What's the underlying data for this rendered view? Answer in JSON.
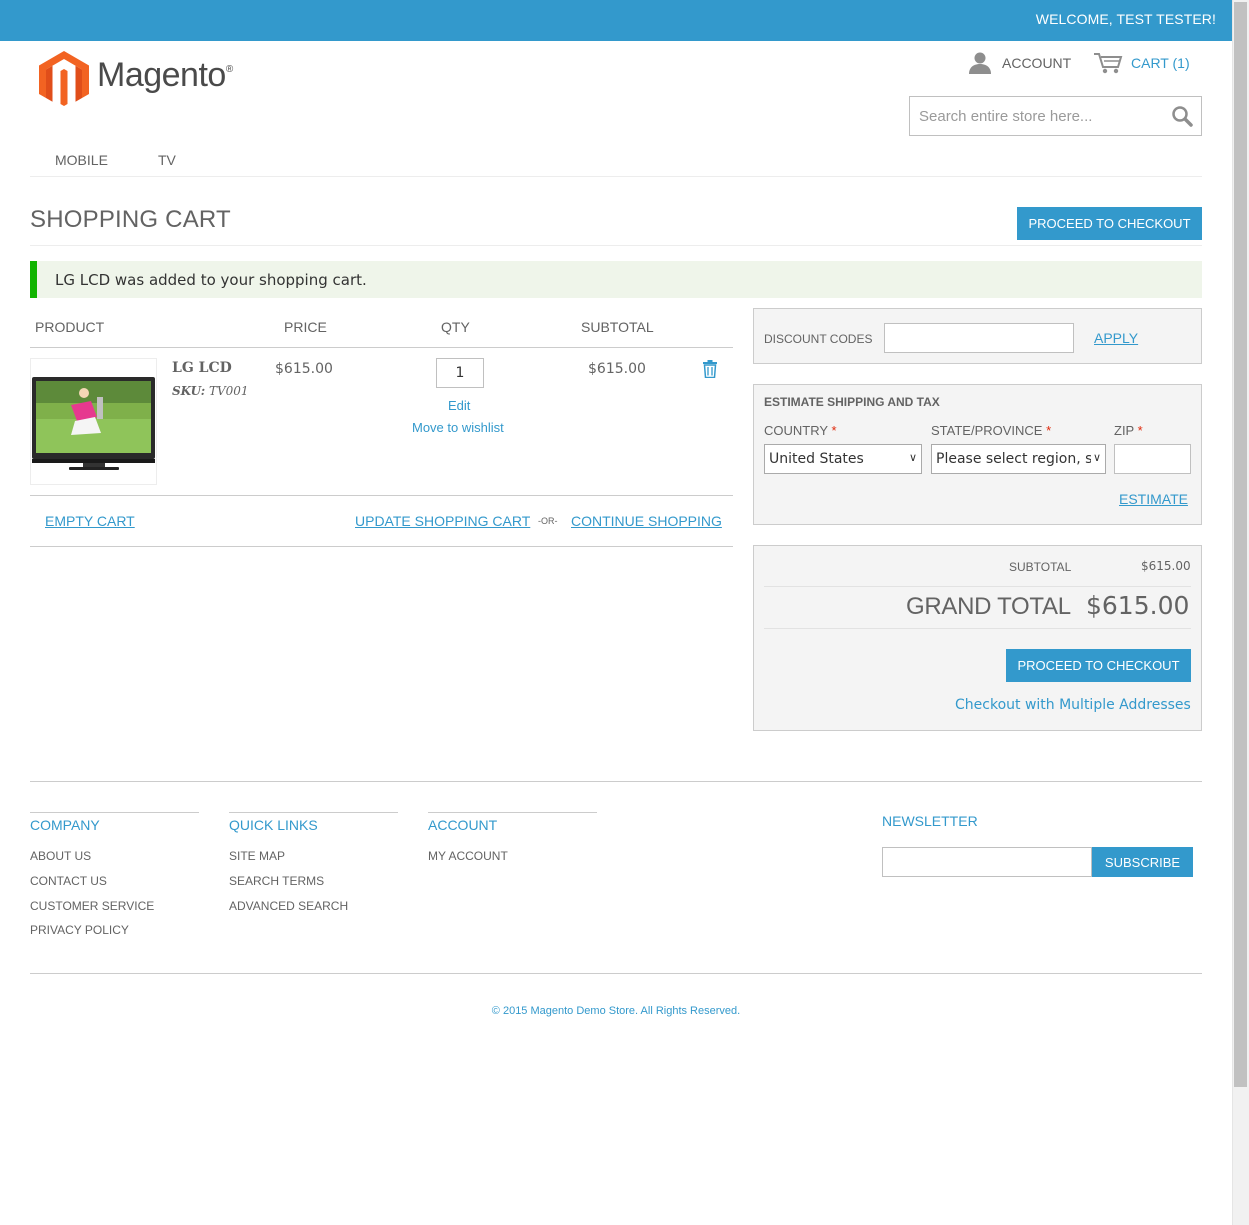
{
  "header": {
    "welcome": "WELCOME, TEST TESTER!",
    "logo_text": "Magento",
    "logo_mark": "®",
    "account_label": "ACCOUNT",
    "cart_label": "CART (1)",
    "search_placeholder": "Search entire store here..."
  },
  "nav": {
    "items": [
      {
        "label": "MOBILE"
      },
      {
        "label": "TV"
      }
    ]
  },
  "page": {
    "title": "SHOPPING CART",
    "checkout_label": "PROCEED TO CHECKOUT",
    "message": "LG LCD was added to your shopping cart."
  },
  "cart": {
    "headers": {
      "product": "PRODUCT",
      "price": "PRICE",
      "qty": "QTY",
      "subtotal": "SUBTOTAL"
    },
    "items": [
      {
        "name": "LG LCD",
        "sku_label": "SKU:",
        "sku": "TV001",
        "price": "$615.00",
        "qty": "1",
        "edit": "Edit",
        "wishlist": "Move to wishlist",
        "subtotal": "$615.00"
      }
    ],
    "empty_cart": "EMPTY CART",
    "update_cart": "UPDATE SHOPPING CART",
    "or": "-OR-",
    "continue_shopping": "CONTINUE SHOPPING"
  },
  "discount": {
    "label": "DISCOUNT CODES",
    "value": "",
    "apply": "APPLY"
  },
  "shipping": {
    "title": "ESTIMATE SHIPPING AND TAX",
    "country_label": "COUNTRY",
    "country_value": "United States",
    "state_label": "STATE/PROVINCE",
    "state_value": "Please select region, s",
    "zip_label": "ZIP",
    "zip_value": "",
    "required_mark": "*",
    "estimate": "ESTIMATE"
  },
  "totals": {
    "subtotal_label": "SUBTOTAL",
    "subtotal_value": "$615.00",
    "grand_label": "GRAND TOTAL",
    "grand_value": "$615.00",
    "checkout_label": "PROCEED TO CHECKOUT",
    "multi": "Checkout with Multiple Addresses"
  },
  "footer": {
    "columns": [
      {
        "title": "COMPANY",
        "links": [
          "ABOUT US",
          "CONTACT US",
          "CUSTOMER SERVICE",
          "PRIVACY POLICY"
        ]
      },
      {
        "title": "QUICK LINKS",
        "links": [
          "SITE MAP",
          "SEARCH TERMS",
          "ADVANCED SEARCH"
        ]
      },
      {
        "title": "ACCOUNT",
        "links": [
          "MY ACCOUNT"
        ]
      }
    ],
    "newsletter_title": "NEWSLETTER",
    "newsletter_value": "",
    "subscribe": "SUBSCRIBE",
    "copyright": "© 2015 Magento Demo Store. All Rights Reserved."
  },
  "colors": {
    "accent": "#3399cc",
    "success": "#11b400",
    "text": "#636363",
    "logo_orange": "#f26322"
  },
  "icons": [
    "account-icon",
    "cart-icon",
    "search-icon",
    "trash-icon",
    "magento-logo-icon"
  ]
}
